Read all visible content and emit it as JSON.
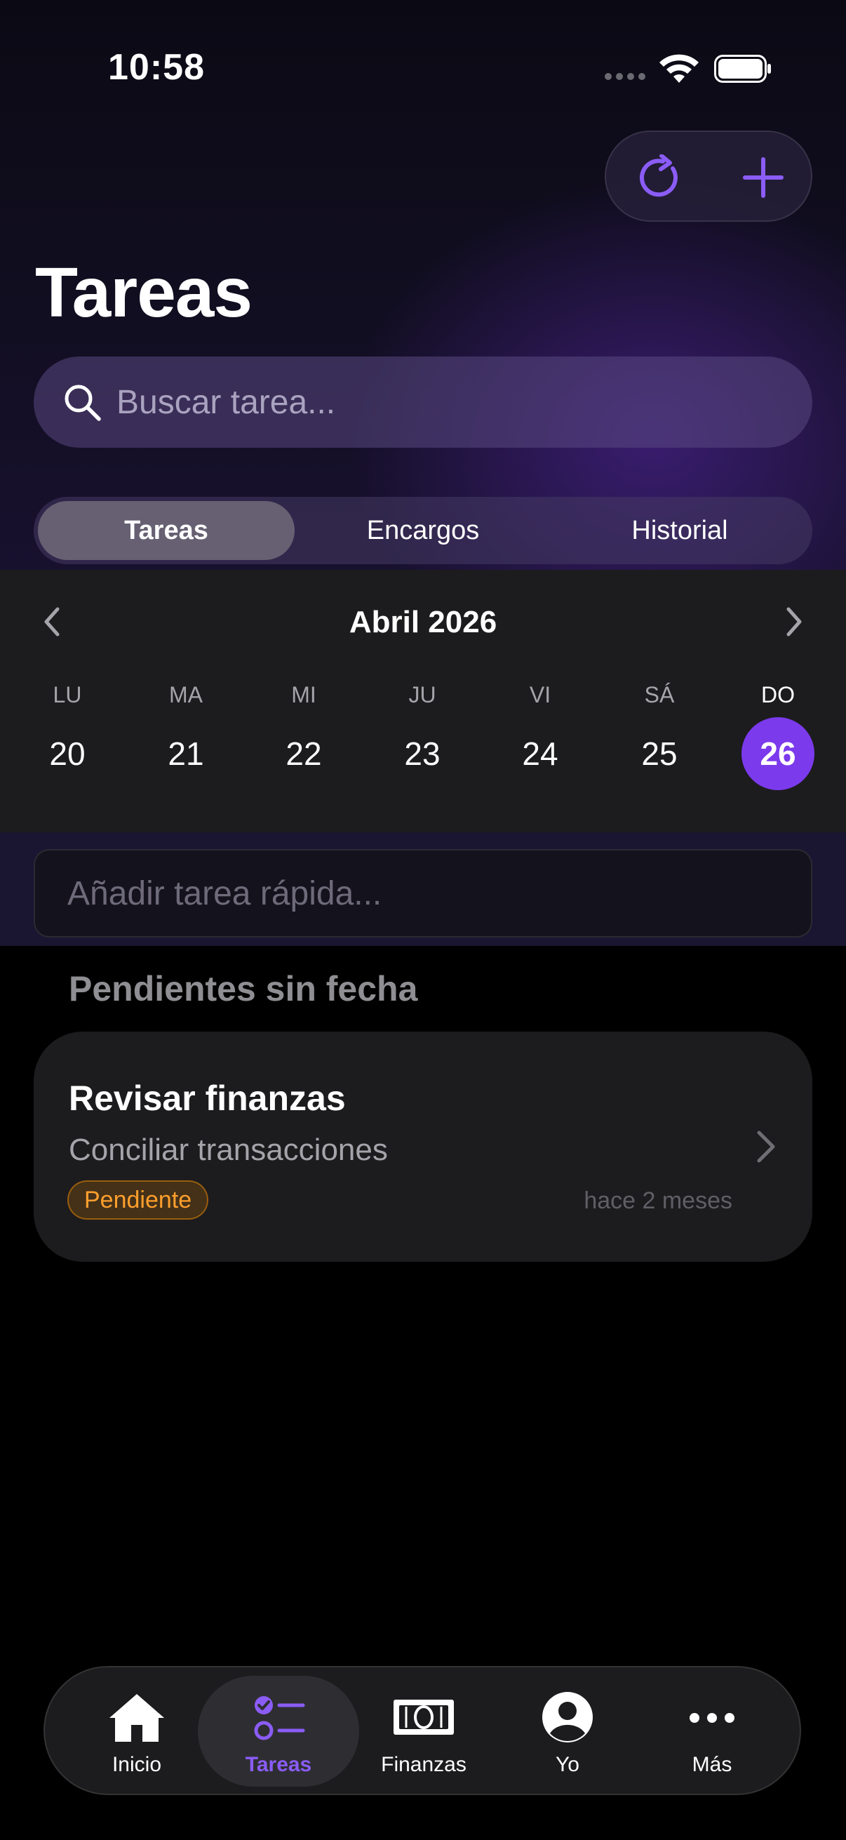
{
  "status_bar": {
    "time": "10:58"
  },
  "header": {
    "title": "Tareas"
  },
  "search": {
    "placeholder": "Buscar tarea..."
  },
  "segments": [
    {
      "label": "Tareas",
      "active": true
    },
    {
      "label": "Encargos",
      "active": false
    },
    {
      "label": "Historial",
      "active": false
    }
  ],
  "calendar": {
    "month_label": "Abril 2026",
    "days": [
      "LU",
      "MA",
      "MI",
      "JU",
      "VI",
      "SÁ",
      "DO"
    ],
    "dates": [
      "20",
      "21",
      "22",
      "23",
      "24",
      "25",
      "26"
    ],
    "selected": "26"
  },
  "quick_add": {
    "placeholder": "Añadir tarea rápida..."
  },
  "section": {
    "title": "Pendientes sin fecha"
  },
  "tasks": [
    {
      "title": "Revisar finanzas",
      "subtitle": "Conciliar transacciones",
      "status": "Pendiente",
      "time_ago": "hace 2 meses"
    }
  ],
  "tabbar": [
    {
      "label": "Inicio",
      "icon": "house-icon",
      "active": false
    },
    {
      "label": "Tareas",
      "icon": "checklist-icon",
      "active": true
    },
    {
      "label": "Finanzas",
      "icon": "banknote-icon",
      "active": false
    },
    {
      "label": "Yo",
      "icon": "person-icon",
      "active": false
    },
    {
      "label": "Más",
      "icon": "ellipsis-icon",
      "active": false
    }
  ],
  "colors": {
    "accent": "#7c3aed",
    "accent_text": "#8b5cf6",
    "pending_badge": "#ff9f2d"
  }
}
